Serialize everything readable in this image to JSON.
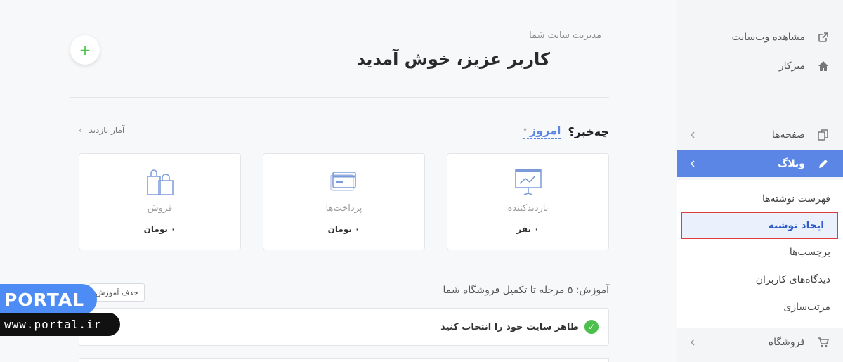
{
  "sidebar": {
    "view_site": "مشاهده وب‌سایت",
    "dashboard": "میزکار",
    "pages": "صفحه‌ها",
    "blog": "وبلاگ",
    "blog_sub": [
      "فهرست نوشته‌ها",
      "ایجاد نوشته",
      "برچسب‌ها",
      "دیدگاه‌های کاربران",
      "مرتب‌سازی"
    ],
    "store": "فروشگاه"
  },
  "header": {
    "breadcrumb": "مدیریت سایت شما",
    "welcome": "کاربر عزیز، خوش آمدید",
    "add_symbol": "+"
  },
  "overview": {
    "question": "چه‌خبر؟",
    "period": "امروز",
    "stats_link": "آمار بازدید"
  },
  "cards": [
    {
      "label": "بازدیدکننده",
      "value": "۰ نفر",
      "icon": "presentation-chart-icon"
    },
    {
      "label": "پرداخت‌ها",
      "value": "۰ تومان",
      "icon": "credit-card-icon"
    },
    {
      "label": "فروش",
      "value": "۰ تومان",
      "icon": "shopping-bags-icon"
    }
  ],
  "tutorial": {
    "title": "آموزش: ۵ مرحله تا تکمیل فروشگاه شما",
    "delete_label": "حذف آموزش",
    "step1": "ظاهر سایت خود را انتخاب کنید"
  },
  "watermark": {
    "brand": "PORTAL",
    "url": "www.portal.ir"
  },
  "colors": {
    "accent": "#5b86e5",
    "success": "#4cbf4c",
    "highlight_border": "#e23b3b"
  }
}
